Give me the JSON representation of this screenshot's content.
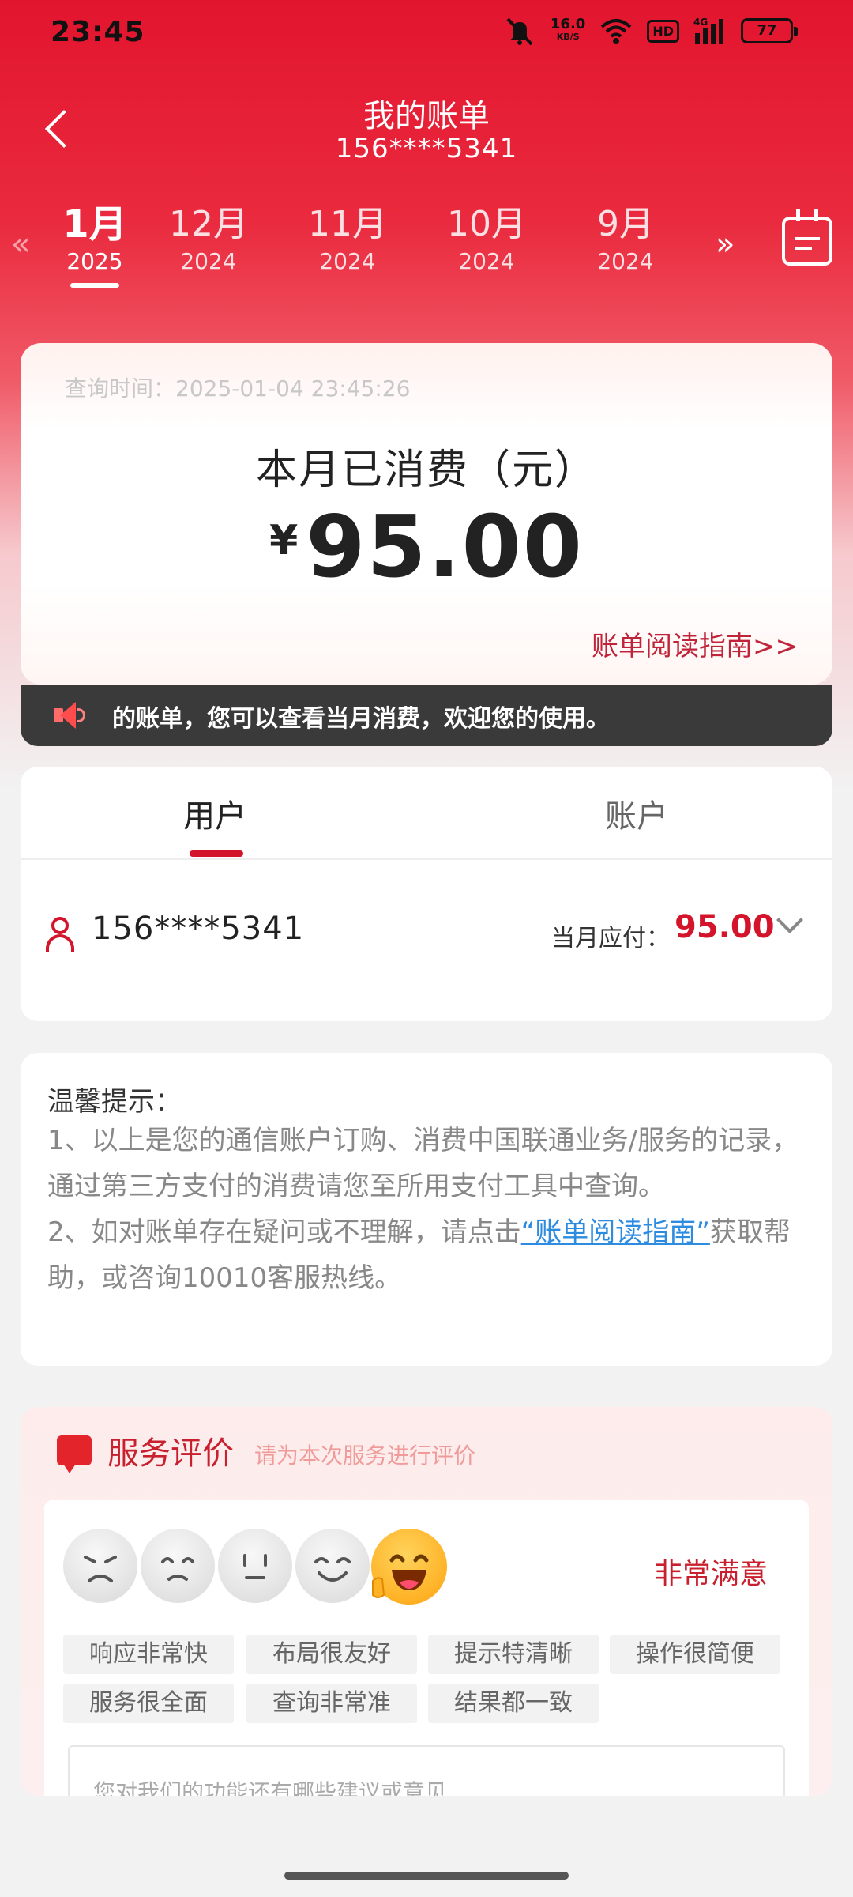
{
  "status": {
    "time": "23:45",
    "net_speed": "16.0",
    "net_unit": "KB/S",
    "hd": "HD",
    "signal": "4G",
    "battery": "77"
  },
  "header": {
    "title": "我的账单",
    "phone": "156****5341"
  },
  "months": [
    {
      "month": "1月",
      "year": "2025"
    },
    {
      "month": "12月",
      "year": "2024"
    },
    {
      "month": "11月",
      "year": "2024"
    },
    {
      "month": "10月",
      "year": "2024"
    },
    {
      "month": "9月",
      "year": "2024"
    }
  ],
  "nav": {
    "prev_icon": "«",
    "next_icon": "»"
  },
  "summary": {
    "query_time": "查询时间：2025-01-04 23:45:26",
    "label": "本月已消费（元）",
    "currency": "¥",
    "amount": "95.00",
    "guide_link": "账单阅读指南>>"
  },
  "notice": {
    "text": "的账单，您可以查看当月消费，欢迎您的使用。"
  },
  "tabs": {
    "user": "用户",
    "account": "账户"
  },
  "user_row": {
    "phone": "156****5341",
    "due_label": "当月应付：",
    "due_value": "95.00"
  },
  "tips": {
    "title": "温馨提示：",
    "line1": "1、以上是您的通信账户订购、消费中国联通业务/服务的记录，通过第三方支付的消费请您至所用支付工具中查询。",
    "line2_pre": "2、如对账单存在疑问或不理解，请点击",
    "line2_link": "“账单阅读指南”",
    "line2_post": "获取帮助，或咨询10010客服热线。"
  },
  "evaluation": {
    "title": "服务评价",
    "subtitle": "请为本次服务进行评价",
    "selected_level": "非常满意",
    "chips": [
      "响应非常快",
      "布局很友好",
      "提示特清晰",
      "操作很简便",
      "服务很全面",
      "查询非常准",
      "结果都一致"
    ],
    "placeholder": "您对我们的功能还有哪些建议或意见"
  },
  "colors": {
    "brand_red": "#e2152e",
    "accent_red": "#d3142b",
    "link_blue": "#2d8ce0"
  }
}
